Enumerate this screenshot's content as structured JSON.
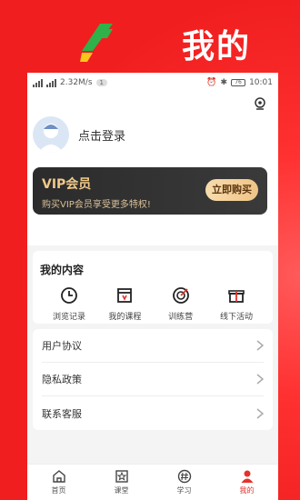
{
  "promo": {
    "title": "我的"
  },
  "statusbar": {
    "network_speed": "2.32M/s",
    "badge": "1",
    "battery": "76",
    "time": "10:01"
  },
  "profile": {
    "login_text": "点击登录"
  },
  "vip": {
    "title": "VIP会员",
    "subtitle": "购买VIP会员享受更多特权!",
    "button": "立即购买"
  },
  "content": {
    "title": "我的内容",
    "items": [
      {
        "label": "浏览记录",
        "icon": "clock-icon"
      },
      {
        "label": "我的课程",
        "icon": "course-icon"
      },
      {
        "label": "训练营",
        "icon": "target-icon"
      },
      {
        "label": "线下活动",
        "icon": "gift-icon"
      }
    ]
  },
  "menu": [
    {
      "label": "用户协议"
    },
    {
      "label": "隐私政策"
    },
    {
      "label": "联系客服"
    }
  ],
  "tabs": [
    {
      "label": "首页",
      "icon": "home-icon",
      "active": false
    },
    {
      "label": "课堂",
      "icon": "classroom-icon",
      "active": false
    },
    {
      "label": "学习",
      "icon": "hash-icon",
      "active": false
    },
    {
      "label": "我的",
      "icon": "user-icon",
      "active": true
    }
  ],
  "colors": {
    "accent": "#e4322b",
    "vip_gold": "#f0c98a",
    "vip_bg": "#2b2b2b"
  }
}
